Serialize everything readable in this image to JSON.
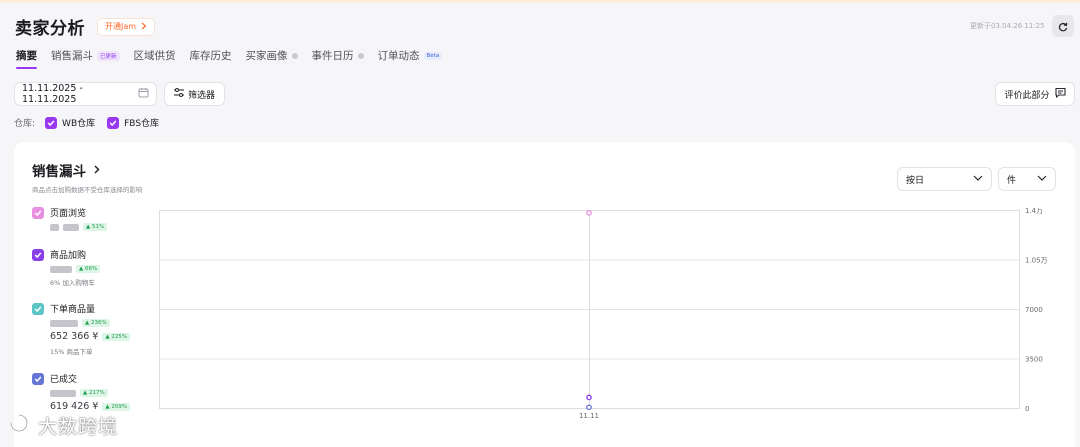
{
  "header": {
    "title": "卖家分析",
    "jam_label": "开通Jam",
    "update_text": "更新于03.04.26 11:25"
  },
  "tabs": [
    {
      "label": "摘要",
      "active": true
    },
    {
      "label": "销售漏斗",
      "badge": "已更新"
    },
    {
      "label": "区域供货"
    },
    {
      "label": "库存历史"
    },
    {
      "label": "买家画像"
    },
    {
      "label": "事件日历"
    },
    {
      "label": "订单动态",
      "badge": "Beta"
    }
  ],
  "toolbar": {
    "date_range": "11.11.2025 - 11.11.2025",
    "filter_label": "筛选器",
    "rate_label": "评价此部分"
  },
  "warehouse": {
    "label": "仓库:",
    "options": [
      "WB仓库",
      "FBS仓库"
    ]
  },
  "funnel": {
    "title": "销售漏斗",
    "subtitle": "商品点击加购数据不受仓库选择的影响",
    "period_select": "按日",
    "unit_select": "件",
    "metrics": [
      {
        "name": "页面浏览",
        "color": "#e98fe0",
        "change": "▲ 51%"
      },
      {
        "name": "商品加购",
        "color": "#8a3ee8",
        "change": "▲ 66%",
        "note": "6% 加入购物车"
      },
      {
        "name": "下单商品量",
        "color": "#5cc6c6",
        "change": "▲ 236%",
        "money": "652 366 ¥",
        "money_change": "▲ 225%",
        "note": "15% 商品下单"
      },
      {
        "name": "已成交",
        "color": "#6676d6",
        "change": "▲ 217%",
        "money": "619 426 ¥",
        "money_change": "▲ 209%"
      }
    ]
  },
  "chart_data": {
    "type": "line",
    "categories": [
      "11.11"
    ],
    "y_ticks": [
      "1.4万",
      "1.05万",
      "7000",
      "3500",
      "0"
    ],
    "ylim": [
      0,
      14000
    ],
    "grid": true,
    "series": [
      {
        "name": "页面浏览",
        "color": "#e98fe0",
        "values": [
          13800
        ]
      },
      {
        "name": "商品加购",
        "color": "#8a3ee8",
        "values": [
          750
        ]
      },
      {
        "name": "已成交",
        "color": "#6676d6",
        "values": [
          50
        ]
      }
    ]
  },
  "watermark": "大数跨境"
}
